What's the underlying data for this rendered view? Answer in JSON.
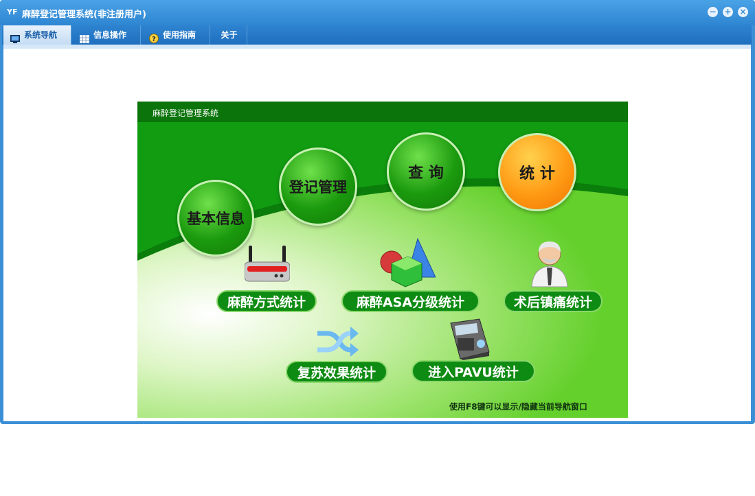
{
  "window": {
    "title": "麻醉登记管理系统(非注册用户)",
    "app_icon": "YF",
    "controls": [
      "minimize-icon",
      "restore-icon",
      "close-icon"
    ]
  },
  "menu": {
    "tabs": [
      {
        "label": "系统导航",
        "icon": "monitor-icon",
        "active": true
      },
      {
        "label": "信息操作",
        "icon": "grid-icon",
        "active": false
      },
      {
        "label": "使用指南",
        "icon": "help-icon",
        "active": false
      },
      {
        "label": "关于",
        "icon": "",
        "active": false
      }
    ]
  },
  "panel": {
    "title": "麻醉登记管理系统",
    "circles": {
      "basic": "基本信息",
      "register": "登记管理",
      "query": "查 询",
      "stats": "统 计"
    },
    "buttons": {
      "anesthesia_method": "麻醉方式统计",
      "asa": "麻醉ASA分级统计",
      "postop": "术后镇痛统计",
      "recovery": "复苏效果统计",
      "pavu": "进入PAVU统计"
    },
    "hint": "使用F8键可以显示/隐藏当前导航窗口"
  },
  "colors": {
    "title_bar": "#3a8fd6",
    "panel_green": "#14a114",
    "accent_orange": "#ff9a14"
  }
}
